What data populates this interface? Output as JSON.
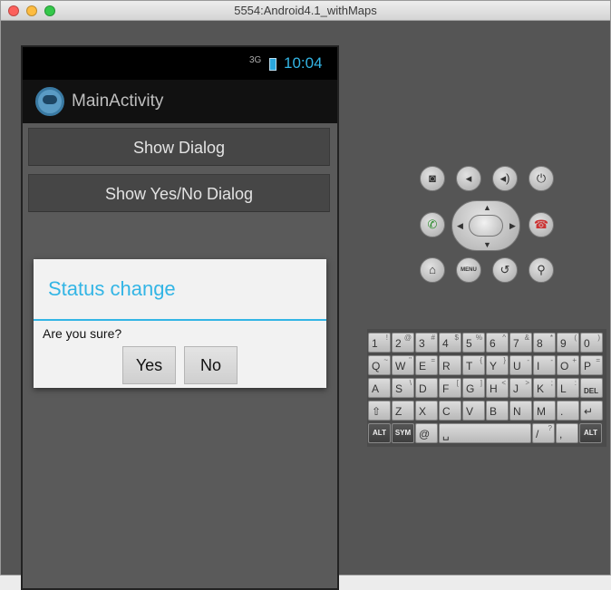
{
  "window": {
    "title": "5554:Android4.1_withMaps"
  },
  "status_bar": {
    "signal": "3G",
    "clock": "10:04"
  },
  "action_bar": {
    "title": "MainActivity"
  },
  "buttons": {
    "show_dialog": "Show Dialog",
    "show_yes_no_dialog": "Show Yes/No Dialog"
  },
  "dialog": {
    "title": "Status change",
    "message": "Are you sure?",
    "yes": "Yes",
    "no": "No"
  },
  "controls": {
    "menu": "MENU"
  },
  "keyboard": {
    "row1": [
      {
        "k": "1",
        "s": "!"
      },
      {
        "k": "2",
        "s": "@"
      },
      {
        "k": "3",
        "s": "#"
      },
      {
        "k": "4",
        "s": "$"
      },
      {
        "k": "5",
        "s": "%"
      },
      {
        "k": "6",
        "s": "^"
      },
      {
        "k": "7",
        "s": "&"
      },
      {
        "k": "8",
        "s": "*"
      },
      {
        "k": "9",
        "s": "("
      },
      {
        "k": "0",
        "s": ")"
      }
    ],
    "row2": [
      {
        "k": "Q",
        "s": "~"
      },
      {
        "k": "W",
        "s": "\""
      },
      {
        "k": "E",
        "s": "="
      },
      {
        "k": "R",
        "s": ""
      },
      {
        "k": "T",
        "s": "{"
      },
      {
        "k": "Y",
        "s": "}"
      },
      {
        "k": "U",
        "s": "-"
      },
      {
        "k": "I",
        "s": "-"
      },
      {
        "k": "O",
        "s": "+"
      },
      {
        "k": "P",
        "s": "="
      }
    ],
    "row3": [
      {
        "k": "A",
        "s": ""
      },
      {
        "k": "S",
        "s": "\\"
      },
      {
        "k": "D",
        "s": ""
      },
      {
        "k": "F",
        "s": "["
      },
      {
        "k": "G",
        "s": "]"
      },
      {
        "k": "H",
        "s": "<"
      },
      {
        "k": "J",
        "s": ">"
      },
      {
        "k": "K",
        "s": ";"
      },
      {
        "k": "L",
        "s": ":"
      },
      {
        "k": "DEL",
        "s": ""
      }
    ],
    "row4": [
      {
        "k": "⇧",
        "s": ""
      },
      {
        "k": "Z",
        "s": ""
      },
      {
        "k": "X",
        "s": ""
      },
      {
        "k": "C",
        "s": ""
      },
      {
        "k": "V",
        "s": ""
      },
      {
        "k": "B",
        "s": ""
      },
      {
        "k": "N",
        "s": ""
      },
      {
        "k": "M",
        "s": ""
      },
      {
        "k": ".",
        "s": ""
      },
      {
        "k": "↵",
        "s": ""
      }
    ],
    "row5": [
      {
        "k": "ALT",
        "s": ""
      },
      {
        "k": "SYM",
        "s": ""
      },
      {
        "k": "@",
        "s": ""
      },
      {
        "k": "␣",
        "s": ""
      },
      {
        "k": "/",
        "s": "?"
      },
      {
        "k": ",",
        "s": ""
      },
      {
        "k": "ALT",
        "s": ""
      }
    ]
  },
  "colors": {
    "accent": "#33b5e5"
  }
}
